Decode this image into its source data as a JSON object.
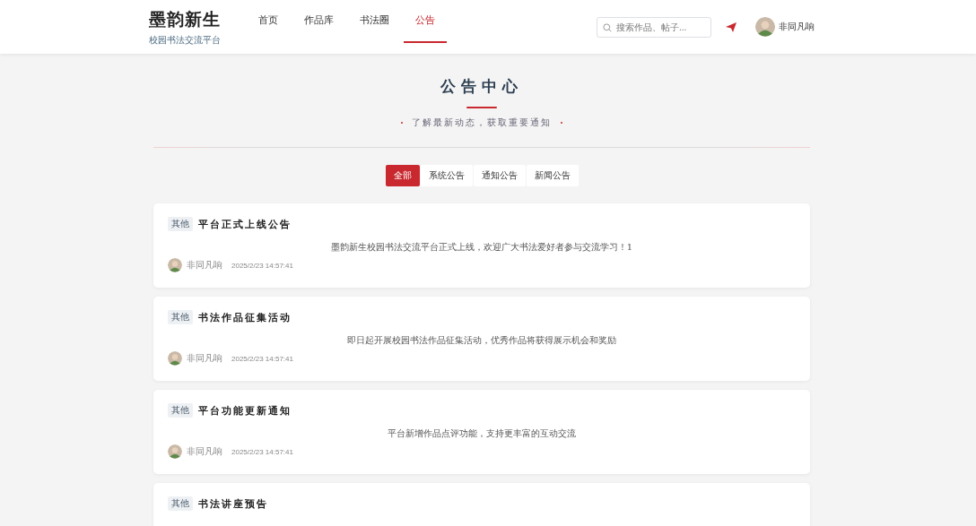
{
  "header": {
    "logo": "墨韵新生",
    "tagline": "校园书法交流平台",
    "nav": [
      {
        "label": "首页",
        "selected": false
      },
      {
        "label": "作品库",
        "selected": false
      },
      {
        "label": "书法圈",
        "selected": false
      },
      {
        "label": "公告",
        "selected": true
      }
    ],
    "search": {
      "placeholder": "搜索作品、帖子..."
    },
    "user": {
      "name": "非同凡响"
    }
  },
  "hero": {
    "title": "公告中心",
    "subtitle": "了解最新动态，获取重要通知"
  },
  "filters": [
    {
      "label": "全部",
      "selected": true
    },
    {
      "label": "系统公告",
      "selected": false
    },
    {
      "label": "通知公告",
      "selected": false
    },
    {
      "label": "新闻公告",
      "selected": false
    }
  ],
  "notices": [
    {
      "tag": "其他",
      "title": "平台正式上线公告",
      "body": "墨韵新生校园书法交流平台正式上线，欢迎广大书法爱好者参与交流学习！1",
      "author": "非同凡响",
      "time": "2025/2/23 14:57:41"
    },
    {
      "tag": "其他",
      "title": "书法作品征集活动",
      "body": "即日起开展校园书法作品征集活动，优秀作品将获得展示机会和奖励",
      "author": "非同凡响",
      "time": "2025/2/23 14:57:41"
    },
    {
      "tag": "其他",
      "title": "平台功能更新通知",
      "body": "平台新增作品点评功能，支持更丰富的互动交流",
      "author": "非同凡响",
      "time": "2025/2/23 14:57:41"
    },
    {
      "tag": "其他",
      "title": "书法讲座预告"
    }
  ]
}
